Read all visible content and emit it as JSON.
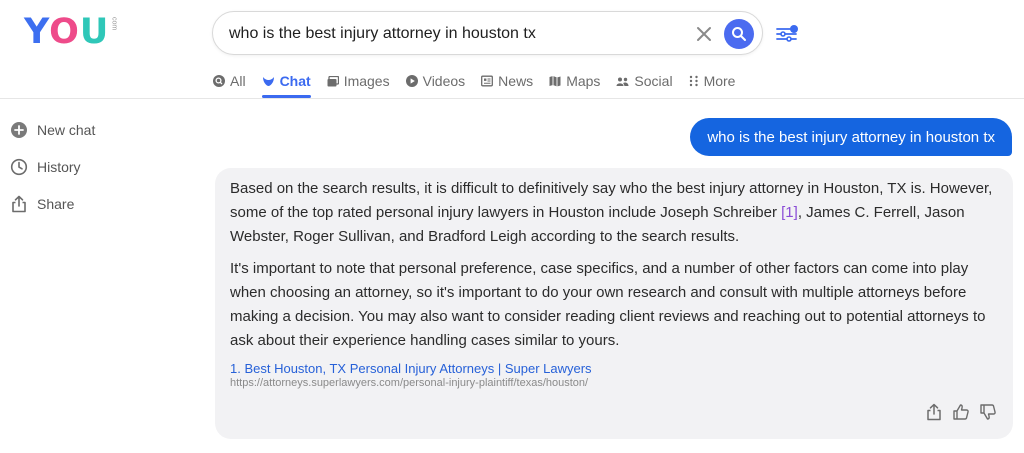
{
  "logo": {
    "y": "Y",
    "o": "O",
    "u": "U",
    "suffix": "com"
  },
  "search": {
    "value": "who is the best injury attorney in houston tx",
    "placeholder": ""
  },
  "tabs": [
    {
      "label": "All"
    },
    {
      "label": "Chat"
    },
    {
      "label": "Images"
    },
    {
      "label": "Videos"
    },
    {
      "label": "News"
    },
    {
      "label": "Maps"
    },
    {
      "label": "Social"
    },
    {
      "label": "More"
    }
  ],
  "active_tab": "Chat",
  "sidebar": {
    "items": [
      {
        "label": "New chat"
      },
      {
        "label": "History"
      },
      {
        "label": "Share"
      }
    ]
  },
  "chat": {
    "user_message": "who is the best injury attorney in houston tx",
    "answer": {
      "p1_a": "Based on the search results, it is difficult to definitively say who the best injury attorney in Houston, TX is. However, some of the top rated personal injury lawyers in Houston include Joseph Schreiber ",
      "p1_cite": "[1]",
      "p1_b": ", James C. Ferrell, Jason Webster, Roger Sullivan, and Bradford Leigh according to the search results.",
      "p2": "It's important to note that personal preference, case specifics, and a number of other factors can come into play when choosing an attorney, so it's important to do your own research and consult with multiple attorneys before making a decision. You may also want to consider reading client reviews and reaching out to potential attorneys to ask about their experience handling cases similar to yours."
    },
    "source": {
      "title": "1. Best Houston, TX Personal Injury Attorneys | Super Lawyers",
      "url": "https://attorneys.superlawyers.com/personal-injury-plaintiff/texas/houston/"
    }
  },
  "colors": {
    "accent": "#3b6af0",
    "user_bubble": "#1565e0",
    "answer_bg": "#f2f2f4",
    "citation": "#8a4cd6",
    "link": "#2761d8"
  }
}
